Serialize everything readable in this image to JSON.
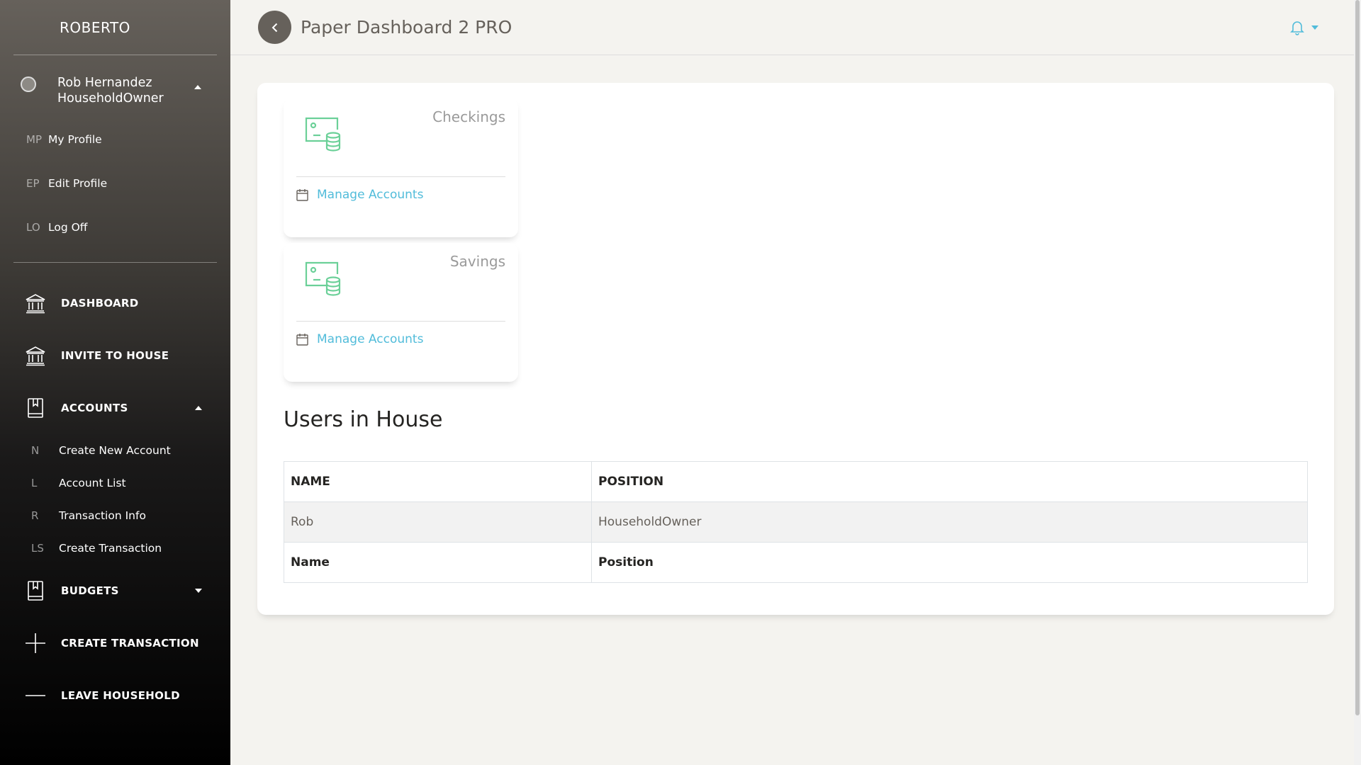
{
  "sidebar": {
    "brand": "ROBERTO",
    "user": {
      "name": "Rob Hernandez",
      "role": "HouseholdOwner",
      "items": [
        {
          "abbr": "MP",
          "label": "My Profile"
        },
        {
          "abbr": "EP",
          "label": "Edit Profile"
        },
        {
          "abbr": "LO",
          "label": "Log Off"
        }
      ]
    },
    "nav": [
      {
        "label": "DASHBOARD",
        "icon": "bank-icon"
      },
      {
        "label": "INVITE TO HOUSE",
        "icon": "bank-icon"
      },
      {
        "label": "ACCOUNTS",
        "icon": "book-bookmark-icon",
        "expanded": true,
        "children": [
          {
            "abbr": "N",
            "label": "Create New Account"
          },
          {
            "abbr": "L",
            "label": "Account List"
          },
          {
            "abbr": "R",
            "label": "Transaction Info"
          },
          {
            "abbr": "LS",
            "label": "Create Transaction"
          }
        ]
      },
      {
        "label": "BUDGETS",
        "icon": "book-bookmark-icon",
        "expanded": false
      },
      {
        "label": "CREATE TRANSACTION",
        "icon": "plus-icon"
      },
      {
        "label": "LEAVE HOUSEHOLD",
        "icon": "minus-icon"
      }
    ]
  },
  "navbar": {
    "title": "Paper Dashboard 2 PRO",
    "bell_icon": "bell-icon"
  },
  "cards": [
    {
      "title": "Checkings",
      "footer": "Manage Accounts",
      "icon": "money-coins-icon"
    },
    {
      "title": "Savings",
      "footer": "Manage Accounts",
      "icon": "money-coins-icon"
    }
  ],
  "users_section": {
    "title": "Users in House",
    "headers": [
      "NAME",
      "POSITION"
    ],
    "rows": [
      [
        "Rob",
        "HouseholdOwner"
      ]
    ],
    "footers": [
      "Name",
      "Position"
    ]
  },
  "colors": {
    "accent": "#51bcda",
    "icon_green": "#6bd098",
    "sidebar_top": "#66615b",
    "sidebar_bottom": "#000000",
    "background": "#f4f3ef"
  }
}
